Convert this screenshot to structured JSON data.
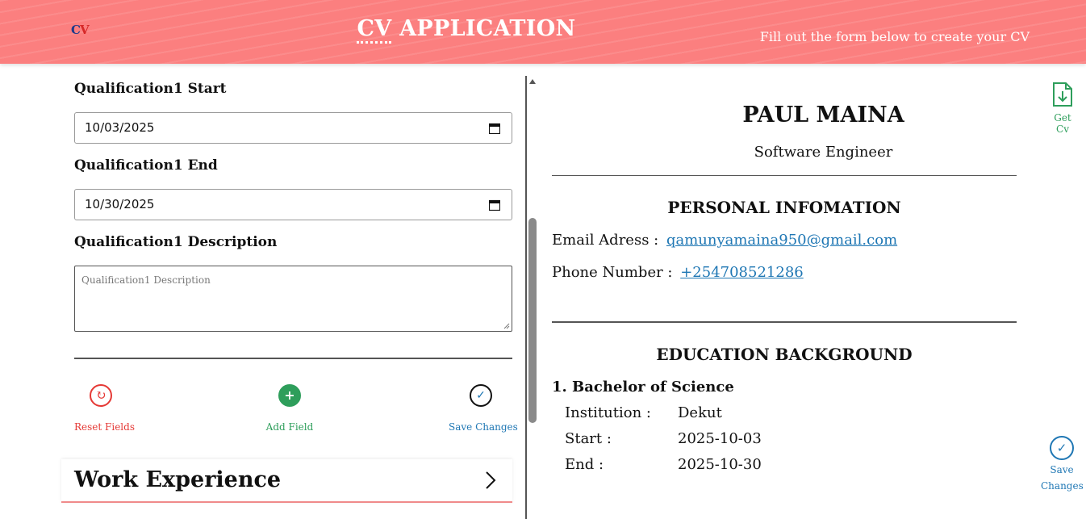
{
  "header": {
    "logo_text": "CV",
    "title_cv": "CV",
    "title_rest": " APPLICATION",
    "subtitle": "Fill out the form below to create your CV"
  },
  "form": {
    "qual_start_label": "Qualification1 Start",
    "qual_start_value": "10/03/2025",
    "qual_end_label": "Qualification1 End",
    "qual_end_value": "10/30/2025",
    "qual_desc_label": "Qualification1 Description",
    "qual_desc_placeholder": "Qualification1 Description",
    "actions": {
      "reset_label": "Reset Fields",
      "reset_icon": "↻",
      "add_label": "Add Field",
      "add_icon": "+",
      "save_label": "Save Changes",
      "save_icon": "✓"
    },
    "work_experience_title": "Work Experience"
  },
  "preview": {
    "name": "PAUL MAINA",
    "role": "Software Engineer",
    "personal_title": "PERSONAL INFOMATION",
    "email_label": "Email Adress :",
    "email_value": "qamunyamaina950@gmail.com",
    "phone_label": "Phone Number :",
    "phone_value": "+254708521286",
    "education_title": "EDUCATION BACKGROUND",
    "education": [
      {
        "heading": "1. Bachelor of Science",
        "institution_label": "Institution :",
        "institution": "Dekut",
        "start_label": "Start :",
        "start": "2025-10-03",
        "end_label": "End :",
        "end": "2025-10-30"
      }
    ]
  },
  "sidebar": {
    "get_cv_label": "Get Cv",
    "save_label_line1": "Save",
    "save_label_line2": "Changes",
    "save_icon": "✓"
  },
  "colors": {
    "header_bg": "#fb7f7f",
    "reset": "#e53935",
    "add": "#2e9e5b",
    "link": "#1f77b4"
  }
}
